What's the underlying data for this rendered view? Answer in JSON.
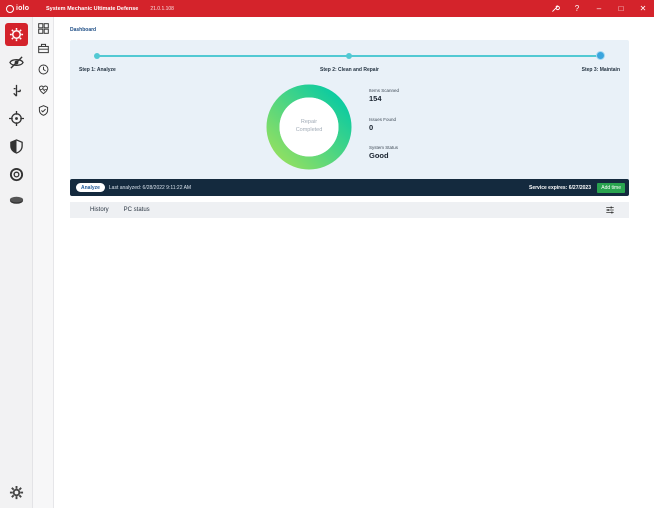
{
  "titlebar": {
    "logo_text": "iolo",
    "app_title": "System Mechanic Ultimate Defense",
    "version": "21.0.1.108",
    "controls": {
      "wrench": "🔧",
      "help": "?",
      "minimize": "–",
      "maximize": "□",
      "close": "✕"
    }
  },
  "rail": {
    "items": [
      "dashboard-gear-icon",
      "privacy-eye-off-icon",
      "usb-icon",
      "crosshair-icon",
      "shield-icon",
      "lifebuoy-icon",
      "eraser-icon"
    ],
    "settings_icon": "gear-icon"
  },
  "subrail": {
    "items": [
      "grid-icon",
      "toolbox-icon",
      "clock-icon",
      "heart-pulse-icon",
      "check-shield-icon"
    ]
  },
  "breadcrumb": "Dashboard",
  "steps": {
    "step1": "Step 1: Analyze",
    "step2": "Step 2: Clean and Repair",
    "step3": "Step 3: Maintain"
  },
  "ring": {
    "line1": "Repair",
    "line2": "Completed",
    "progress": 1.0
  },
  "stats": {
    "items_scanned_label": "Items Scanned",
    "items_scanned_value": "154",
    "issues_found_label": "Issues Found",
    "issues_found_value": "0",
    "system_status_label": "System Status",
    "system_status_value": "Good"
  },
  "statusbar": {
    "analyze_label": "Analyze",
    "last_analyzed": "Last analyzed: 6/28/2022 9:11:22 AM",
    "service_expires": "Service expires:  6/27/2023",
    "add_time_label": "Add time"
  },
  "tabs": {
    "history": "History",
    "pc_status": "PC status"
  },
  "colors": {
    "brand_red": "#d4232b",
    "ring_start": "#9be15d",
    "ring_end": "#00c9a7",
    "status_dark": "#142a3e",
    "add_time_green": "#29a34f"
  }
}
